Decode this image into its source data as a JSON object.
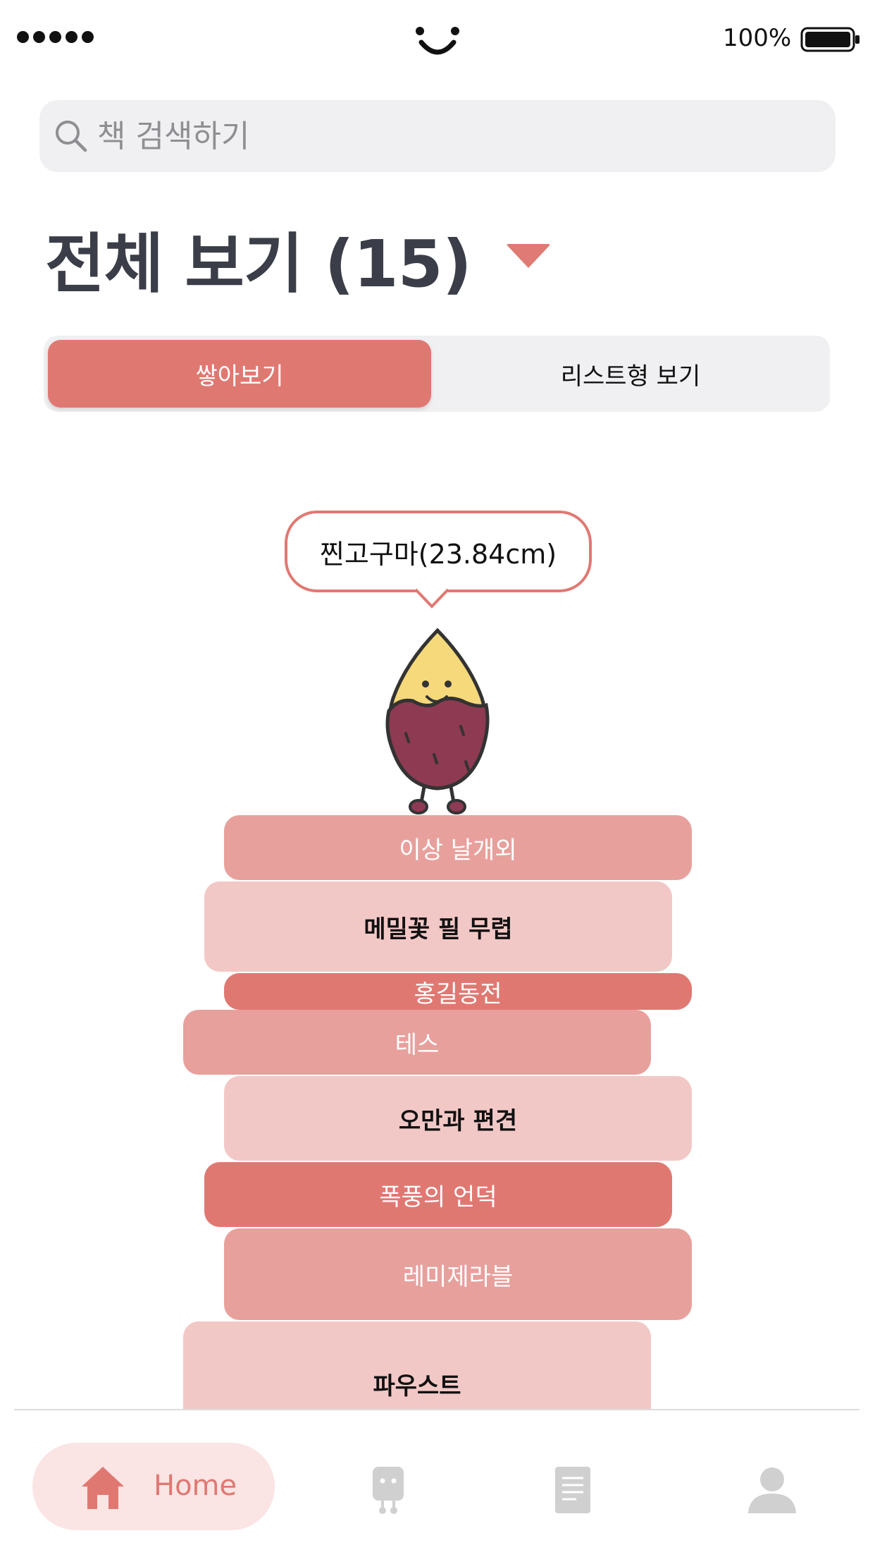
{
  "status_bar": {
    "battery_percent": "100%"
  },
  "search": {
    "placeholder": "책 검색하기"
  },
  "heading": {
    "title": "전체 보기 (15)"
  },
  "view_toggle": {
    "stack_label": "쌓아보기",
    "list_label": "리스트형 보기",
    "selected": "stack"
  },
  "bubble": {
    "text": "찐고구마(23.84cm)"
  },
  "books": [
    {
      "title": "이상 날개외",
      "color": "#e8a09d",
      "text_color": "#ffffff"
    },
    {
      "title": "메밀꽃 필 무렵",
      "color": "#f2c8c6",
      "text_color": "#111111"
    },
    {
      "title": "홍길동전",
      "color": "#e07872",
      "text_color": "#ffffff"
    },
    {
      "title": "테스",
      "color": "#e8a09d",
      "text_color": "#ffffff"
    },
    {
      "title": "오만과 편견",
      "color": "#f2c8c6",
      "text_color": "#111111"
    },
    {
      "title": "폭풍의 언덕",
      "color": "#e07872",
      "text_color": "#ffffff"
    },
    {
      "title": "레미제라블",
      "color": "#e8a09d",
      "text_color": "#ffffff"
    },
    {
      "title": "파우스트",
      "color": "#f2c8c6",
      "text_color": "#111111"
    }
  ],
  "bottom_nav": {
    "home_label": "Home",
    "items": [
      "home-icon",
      "robot-icon",
      "document-icon",
      "profile-icon"
    ],
    "active": "Home",
    "accent_color": "#e07872",
    "inactive_color": "#d0d0d0"
  }
}
